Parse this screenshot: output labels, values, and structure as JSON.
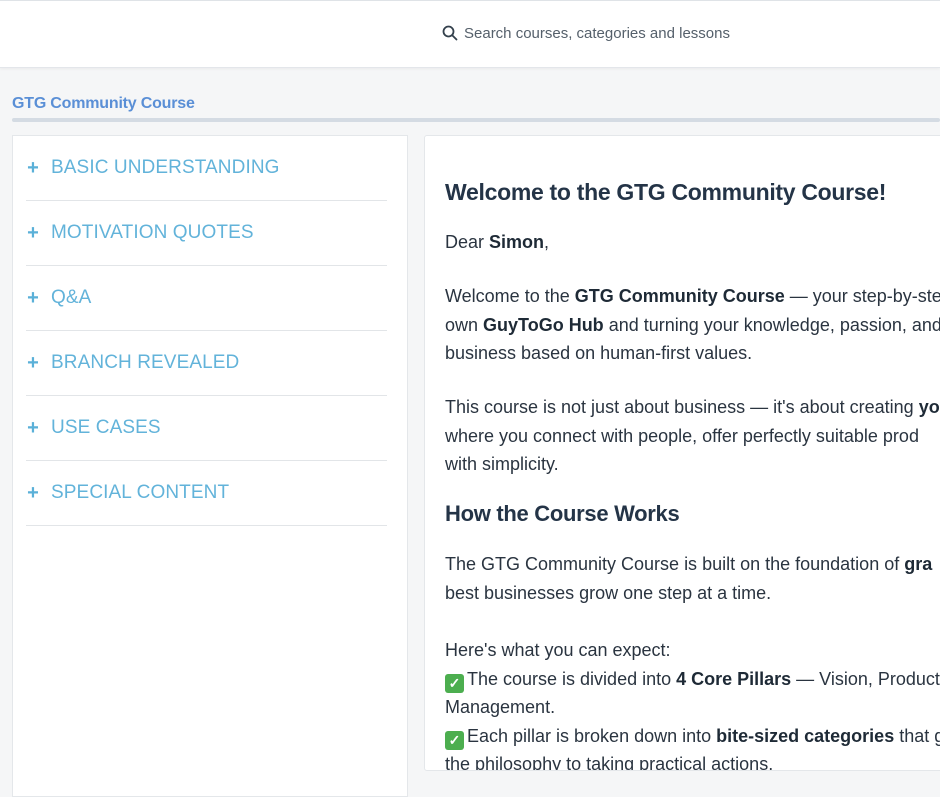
{
  "search": {
    "placeholder": "Search courses, categories and lessons"
  },
  "course": {
    "title": "GTG Community Course"
  },
  "sidebar": {
    "items": [
      {
        "label": "BASIC UNDERSTANDING"
      },
      {
        "label": "MOTIVATION QUOTES"
      },
      {
        "label": "Q&A"
      },
      {
        "label": "BRANCH REVEALED"
      },
      {
        "label": "USE CASES"
      },
      {
        "label": "SPECIAL CONTENT"
      }
    ]
  },
  "content": {
    "heading": "Welcome to the GTG Community Course!",
    "greeting_prefix": "Dear ",
    "greeting_name": "Simon",
    "greeting_suffix": ",",
    "p1_a": "Welcome to the ",
    "p1_b": "GTG Community Course",
    "p1_c": " — your step-by-ste",
    "p1_d": "own ",
    "p1_e": "GuyToGo Hub",
    "p1_f": " and turning your knowledge, passion, and",
    "p1_g": "business based on human-first values.",
    "p2_a": "This course is not just about business — it's about creating ",
    "p2_b": "yo",
    "p2_c": "where you connect with people, offer perfectly suitable prod",
    "p2_d": "with simplicity.",
    "heading2": "How the Course Works",
    "p3_a": "The GTG Community Course is built on the foundation of ",
    "p3_b": "gra",
    "p3_c": "best businesses grow one step at a time.",
    "p4": "Here's what you can expect:",
    "li1_a": "The course is divided into ",
    "li1_b": "4 Core Pillars",
    "li1_c": " — Vision, Product",
    "li1_d": "Management.",
    "li2_a": "Each pillar is broken down into ",
    "li2_b": "bite-sized categories",
    "li2_c": " that g",
    "li2_d": "the philosophy to taking practical actions."
  },
  "icons": {
    "search": "search-icon",
    "expand": "plus-icon",
    "check": "check-box-icon"
  },
  "colors": {
    "accent": "#62b3da",
    "title": "#5a8fd6",
    "check": "#4cae4f"
  }
}
